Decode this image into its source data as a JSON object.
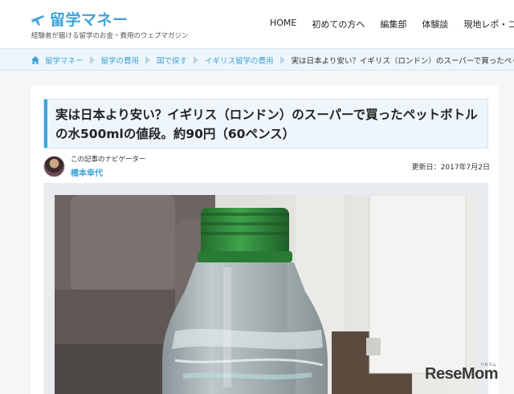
{
  "header": {
    "logo_text": "留学マネー",
    "tagline": "経験者が届ける留学のお金・費用のウェブマガジン",
    "nav": [
      "HOME",
      "初めての方へ",
      "編集部",
      "体験談",
      "現地レポ・コラム"
    ]
  },
  "breadcrumb": {
    "items": [
      "留学マネー",
      "留学の費用",
      "国で探す",
      "イギリス留学の費用"
    ],
    "current": "実は日本より安い？イギリス（ロンドン）のスーパーで買ったペットボ"
  },
  "article": {
    "title": "実は日本より安い？イギリス（ロンドン）のスーパーで買ったペットボトルの水500mlの値段。約90円（60ペンス）",
    "navigator_role": "この記事のナビゲーター",
    "navigator_name": "橋本幸代",
    "updated": "更新日：2017年7月2日"
  },
  "watermark": {
    "brand": "ReseMom",
    "sub": "リセマム"
  },
  "colors": {
    "accent": "#3ea2d8",
    "bottle_cap": "#2f8a3a"
  }
}
